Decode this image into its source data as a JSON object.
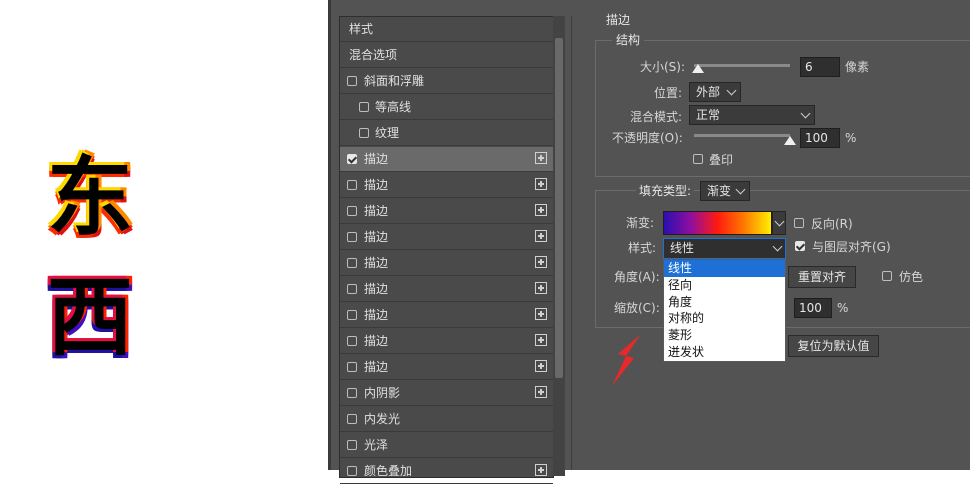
{
  "canvas": {
    "glyph_top": "东",
    "glyph_bottom": "西"
  },
  "style_list": {
    "items": [
      {
        "label": "样式",
        "checkbox": false,
        "checked": false,
        "indent": false,
        "plus": false,
        "selected": false
      },
      {
        "label": "混合选项",
        "checkbox": false,
        "checked": false,
        "indent": false,
        "plus": false,
        "selected": false
      },
      {
        "label": "斜面和浮雕",
        "checkbox": true,
        "checked": false,
        "indent": false,
        "plus": false,
        "selected": false
      },
      {
        "label": "等高线",
        "checkbox": true,
        "checked": false,
        "indent": true,
        "plus": false,
        "selected": false
      },
      {
        "label": "纹理",
        "checkbox": true,
        "checked": false,
        "indent": true,
        "plus": false,
        "selected": false
      },
      {
        "label": "描边",
        "checkbox": true,
        "checked": true,
        "indent": false,
        "plus": true,
        "selected": true
      },
      {
        "label": "描边",
        "checkbox": true,
        "checked": false,
        "indent": false,
        "plus": true,
        "selected": false
      },
      {
        "label": "描边",
        "checkbox": true,
        "checked": false,
        "indent": false,
        "plus": true,
        "selected": false
      },
      {
        "label": "描边",
        "checkbox": true,
        "checked": false,
        "indent": false,
        "plus": true,
        "selected": false
      },
      {
        "label": "描边",
        "checkbox": true,
        "checked": false,
        "indent": false,
        "plus": true,
        "selected": false
      },
      {
        "label": "描边",
        "checkbox": true,
        "checked": false,
        "indent": false,
        "plus": true,
        "selected": false
      },
      {
        "label": "描边",
        "checkbox": true,
        "checked": false,
        "indent": false,
        "plus": true,
        "selected": false
      },
      {
        "label": "描边",
        "checkbox": true,
        "checked": false,
        "indent": false,
        "plus": true,
        "selected": false
      },
      {
        "label": "描边",
        "checkbox": true,
        "checked": false,
        "indent": false,
        "plus": true,
        "selected": false
      },
      {
        "label": "内阴影",
        "checkbox": true,
        "checked": false,
        "indent": false,
        "plus": true,
        "selected": false
      },
      {
        "label": "内发光",
        "checkbox": true,
        "checked": false,
        "indent": false,
        "plus": false,
        "selected": false
      },
      {
        "label": "光泽",
        "checkbox": true,
        "checked": false,
        "indent": false,
        "plus": false,
        "selected": false
      },
      {
        "label": "颜色叠加",
        "checkbox": true,
        "checked": false,
        "indent": false,
        "plus": true,
        "selected": false
      }
    ]
  },
  "stroke": {
    "title": "描边",
    "structure": {
      "title": "结构",
      "size_label": "大小(S):",
      "size_value": "6",
      "size_unit": "像素",
      "size_level": 0.04,
      "position_label": "位置:",
      "position_value": "外部",
      "blend_label": "混合模式:",
      "blend_value": "正常",
      "opacity_label": "不透明度(O):",
      "opacity_value": "100",
      "opacity_unit": "%",
      "opacity_level": 1.0,
      "overprint_label": "叠印",
      "overprint_checked": false
    },
    "fill": {
      "fill_type_label": "填充类型:",
      "fill_type_value": "渐变",
      "gradient_label": "渐变:",
      "reverse_label": "反向(R)",
      "reverse_checked": false,
      "style_label": "样式:",
      "style_value": "线性",
      "align_label": "与图层对齐(G)",
      "align_checked": true,
      "angle_label": "角度(A):",
      "reset_align_button": "重置对齐",
      "dither_label": "仿色",
      "dither_checked": false,
      "scale_label": "缩放(C):",
      "scale_value": "100",
      "scale_unit": "%"
    },
    "reset_default_button": "复位为默认值",
    "style_dropdown_options": [
      "线性",
      "径向",
      "角度",
      "对称的",
      "菱形",
      "迸发状"
    ],
    "style_dropdown_highlighted": 0
  },
  "colors": {
    "dialog_bg": "#535353",
    "list_selected": "#6a6a6a",
    "highlight_blue": "#1e70d6",
    "arrow_red": "#e8282a"
  }
}
